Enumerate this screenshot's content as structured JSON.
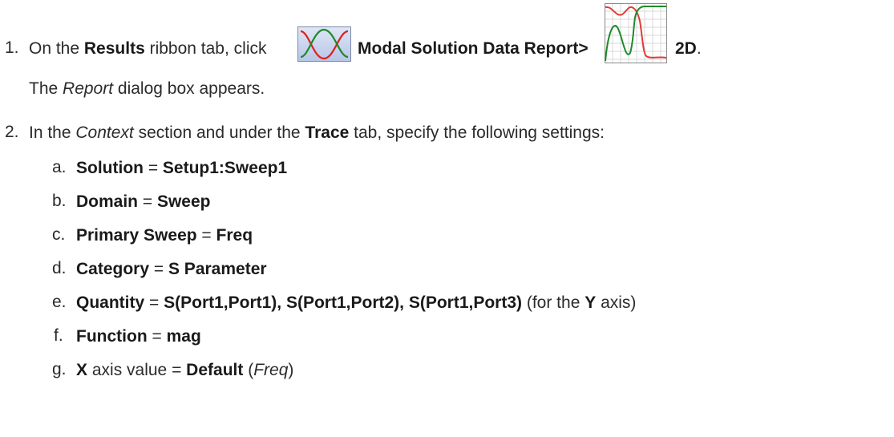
{
  "step1": {
    "number": "1.",
    "pre": "On the ",
    "tab": "Results",
    "mid": " ribbon tab, click ",
    "cmd": "Modal Solution Data Report>",
    "option": "2D",
    "end": ".",
    "result_pre": "The ",
    "result_dialog": "Report",
    "result_post": " dialog box appears.",
    "icons": [
      "modal-solution-data-report-icon",
      "rectangular-plot-2d-icon"
    ]
  },
  "step2": {
    "number": "2.",
    "pre": "In the ",
    "section": "Context",
    "mid": " section and under the ",
    "tab": "Trace",
    "post": " tab, specify the following settings:",
    "items": [
      {
        "letter": "a.",
        "key": "Solution",
        "eq": " = ",
        "value": "Setup1:Sweep1"
      },
      {
        "letter": "b.",
        "key": "Domain",
        "eq": " = ",
        "value": "Sweep"
      },
      {
        "letter": "c.",
        "key": "Primary Sweep",
        "eq": " = ",
        "value": "Freq"
      },
      {
        "letter": "d.",
        "key": "Category",
        "eq": " = ",
        "value": "S Parameter"
      },
      {
        "letter": "e.",
        "key": "Quantity",
        "eq": " = ",
        "value": "S(Port1,Port1), S(Port1,Port2), S(Port1,Port3)",
        "note_pre": " (for the ",
        "note_bold": "Y",
        "note_post": " axis)"
      },
      {
        "letter": "f.",
        "key": "Function",
        "eq": " = ",
        "value": "mag"
      },
      {
        "letter": "g.",
        "key": "X",
        "eq": " axis value = ",
        "value": "Default",
        "note_pre": " (",
        "note_italic": "Freq",
        "note_post": ")"
      }
    ]
  }
}
